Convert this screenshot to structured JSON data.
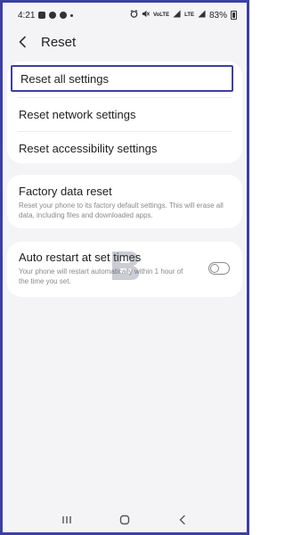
{
  "status_bar": {
    "time": "4:21",
    "network_label": "LTE",
    "volte_label": "VoLTE",
    "battery": "83%",
    "icons": [
      "gallery-icon",
      "notification-icon",
      "messenger-icon",
      "alarm-icon",
      "mute-icon",
      "signal-icon",
      "battery-icon"
    ]
  },
  "header": {
    "title": "Reset"
  },
  "reset_group": {
    "items": [
      {
        "label": "Reset all settings"
      },
      {
        "label": "Reset network settings"
      },
      {
        "label": "Reset accessibility settings"
      }
    ]
  },
  "factory": {
    "label": "Factory data reset",
    "description": "Reset your phone to its factory default settings. This will erase all data, including files and downloaded apps."
  },
  "auto_restart": {
    "label": "Auto restart at set times",
    "description": "Your phone will restart automatically within 1 hour of the time you set.",
    "enabled": false
  },
  "watermark_text": "B",
  "colors": {
    "highlight_border": "#3d3fa3",
    "background": "#f4f4f7",
    "card": "#ffffff"
  }
}
